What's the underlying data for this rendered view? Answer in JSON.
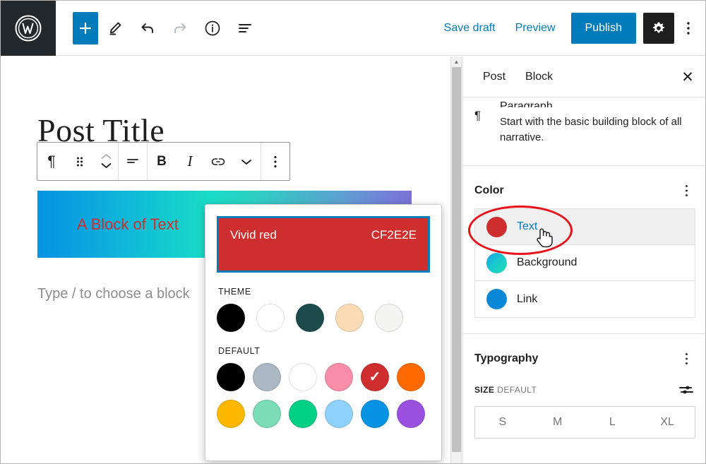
{
  "app": {
    "name": "WordPress Block Editor",
    "logo_icon": "wordpress-logo-icon"
  },
  "topbar": {
    "add_block_label": "+",
    "add_block_icon": "plus-icon",
    "edit_tool_icon": "pencil-icon",
    "undo_icon": "undo-arrow-icon",
    "redo_icon": "redo-arrow-icon",
    "info_icon": "info-circle-icon",
    "list_view_icon": "list-view-icon",
    "save_draft_label": "Save draft",
    "preview_label": "Preview",
    "publish_label": "Publish",
    "settings_icon": "gear-icon",
    "options_icon": "vertical-ellipsis-icon",
    "accent_color": "#007cba"
  },
  "block_toolbar": {
    "paragraph_icon": "paragraph-pilcrow-icon",
    "paragraph_glyph": "¶",
    "drag_icon": "drag-handle-dots-icon",
    "move_up_icon": "chevron-up-icon",
    "move_down_icon": "chevron-down-icon",
    "align_icon": "align-text-icon",
    "bold_label": "B",
    "italic_label": "I",
    "link_icon": "link-icon",
    "more_formats_icon": "chevron-down-icon",
    "options_icon": "vertical-ellipsis-icon"
  },
  "canvas": {
    "post_title": "Post Title",
    "block_text": "A Block of Text",
    "block_text_color": "#cf2e2e",
    "gradient_start": "#0693e3",
    "gradient_mid": "#19dcc6",
    "gradient_end": "#7a71d8",
    "placeholder": "Type / to choose a block"
  },
  "sidebar": {
    "tabs": [
      {
        "label": "Post",
        "active": false
      },
      {
        "label": "Block",
        "active": true
      }
    ],
    "close_icon": "close-x-icon",
    "close_label": "✕",
    "block_info": {
      "icon": "paragraph-pilcrow-icon",
      "icon_glyph": "¶",
      "title": "Paragraph",
      "description": "Start with the basic building block of all narrative."
    },
    "color_section": {
      "title": "Color",
      "kebab_icon": "vertical-ellipsis-icon",
      "rows": [
        {
          "label": "Text",
          "color": "#cf2e2e",
          "active": true,
          "swatch_icon": "color-swatch-icon"
        },
        {
          "label": "Background",
          "color": "linear-gradient(135deg,#1c9fe8 0%,#18c7cf 45%,#22e0b0 100%)",
          "active": false,
          "swatch_icon": "gradient-swatch-icon"
        },
        {
          "label": "Link",
          "color": "#0b87d8",
          "active": false,
          "swatch_icon": "color-swatch-icon"
        }
      ]
    },
    "typography_section": {
      "title": "Typography",
      "kebab_icon": "vertical-ellipsis-icon",
      "size_key": "SIZE",
      "size_value": "DEFAULT",
      "settings_icon": "sliders-icon",
      "sizes": [
        "S",
        "M",
        "L",
        "XL"
      ]
    }
  },
  "color_popover": {
    "preview_name": "Vivid red",
    "preview_hex": "CF2E2E",
    "preview_bg": "#cf2e2e",
    "focus_border": "#007cba",
    "theme_label": "THEME",
    "theme_colors": [
      {
        "name": "Black",
        "hex": "#000000"
      },
      {
        "name": "White",
        "hex": "#ffffff"
      },
      {
        "name": "Dark teal",
        "hex": "#1d4b4b"
      },
      {
        "name": "Peach",
        "hex": "#fbdab6"
      },
      {
        "name": "Off white",
        "hex": "#f4f4f2"
      }
    ],
    "default_label": "DEFAULT",
    "default_colors": [
      {
        "name": "Black",
        "hex": "#000000",
        "selected": false
      },
      {
        "name": "Cyan bluish gray",
        "hex": "#abb8c3",
        "selected": false
      },
      {
        "name": "White",
        "hex": "#ffffff",
        "selected": false
      },
      {
        "name": "Pale pink",
        "hex": "#f78da7",
        "selected": false
      },
      {
        "name": "Vivid red",
        "hex": "#cf2e2e",
        "selected": true
      },
      {
        "name": "Luminous vivid orange",
        "hex": "#ff6900",
        "selected": false
      },
      {
        "name": "Luminous vivid amber",
        "hex": "#fcb900",
        "selected": false
      },
      {
        "name": "Light green cyan",
        "hex": "#7bdcb5",
        "selected": false
      },
      {
        "name": "Vivid green cyan",
        "hex": "#00d084",
        "selected": false
      },
      {
        "name": "Pale cyan blue",
        "hex": "#8ed1fc",
        "selected": false
      },
      {
        "name": "Vivid cyan blue",
        "hex": "#0693e3",
        "selected": false
      },
      {
        "name": "Vivid purple",
        "hex": "#9b51e0",
        "selected": false
      }
    ],
    "selected_check": "✓"
  },
  "annotation": {
    "ellipse_color": "#e8121a",
    "shape": "ellipse-highlight",
    "cursor": "pointing-hand-cursor"
  },
  "scrollbar": {
    "up_arrow_icon": "scroll-up-arrow-icon"
  }
}
